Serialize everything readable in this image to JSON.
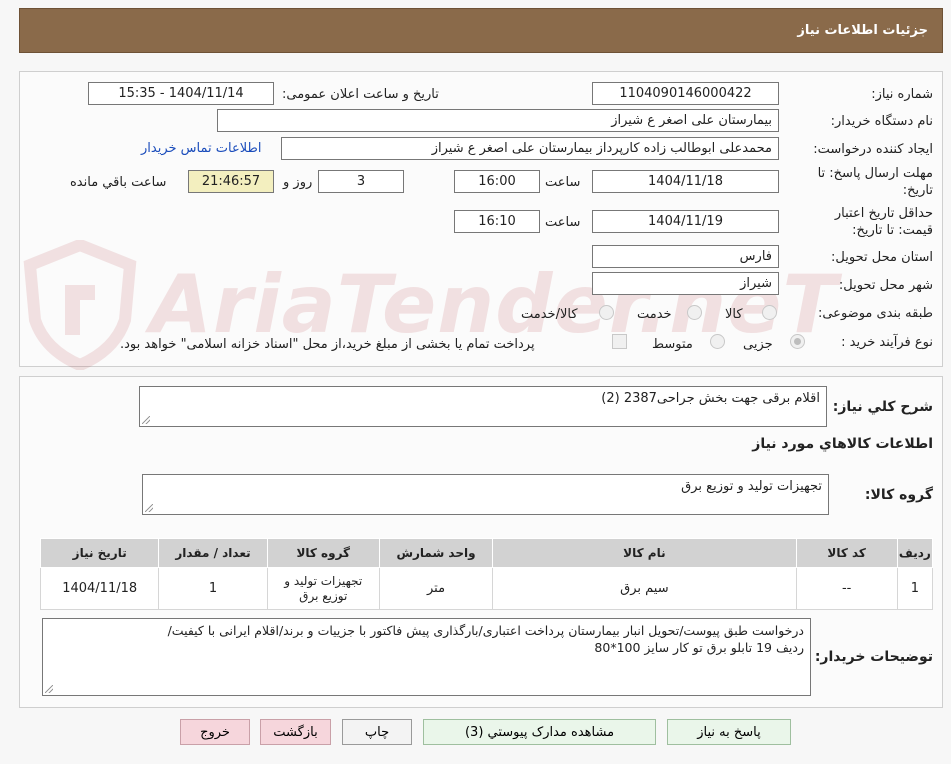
{
  "header": {
    "title": "جزئیات اطلاعات نیاز"
  },
  "form": {
    "need_number": {
      "label": "شماره نیاز:",
      "value": "1104090146000422"
    },
    "announce": {
      "label": "تاریخ و ساعت اعلان عمومی:",
      "value": "1404/11/14 - 15:35"
    },
    "buyer": {
      "label": "نام دستگاه خریدار:",
      "value": "بیمارستان علی اصغر  ع  شیراز"
    },
    "requester": {
      "label": "ایجاد کننده درخواست:",
      "value": "محمدعلی ابوطالب زاده کارپرداز بیمارستان علی اصغر  ع  شیراز"
    },
    "contact_link": "اطلاعات تماس خریدار",
    "deadline": {
      "label_line1": "مهلت ارسال پاسخ: تا",
      "label_line2": "تاریخ:",
      "date": "1404/11/18",
      "time_label": "ساعت",
      "time": "16:00",
      "days": "3",
      "days_label": "روز و",
      "remaining": "21:46:57",
      "remaining_label": "ساعت باقي مانده"
    },
    "validity": {
      "label_line1": "حداقل تاریخ اعتبار",
      "label_line2": "قیمت: تا تاریخ:",
      "date": "1404/11/19",
      "time_label": "ساعت",
      "time": "16:10"
    },
    "province": {
      "label": "استان محل تحویل:",
      "value": "فارس"
    },
    "city": {
      "label": "شهر محل تحویل:",
      "value": "شیراز"
    },
    "category": {
      "label": "طبقه بندی موضوعی:",
      "options": [
        "کالا",
        "خدمت",
        "کالا/خدمت"
      ]
    },
    "process": {
      "label": "نوع فرآیند خرید :",
      "options": [
        "جزیی",
        "متوسط"
      ],
      "note": "پرداخت تمام یا بخشی از مبلغ خرید،از محل \"اسناد خزانه اسلامی\" خواهد بود."
    }
  },
  "summary": {
    "label": "شرح کلي نياز:",
    "value": "اقلام برقی جهت بخش جراحی2387 (2)",
    "goods_heading": "اطلاعات کالاهاي مورد نياز",
    "group_label": "گروه کالا:",
    "group_value": "تجهیزات تولید و توزیع برق"
  },
  "table": {
    "headers": [
      "رديف",
      "کد کالا",
      "نام کالا",
      "واحد شمارش",
      "گروه کالا",
      "تعداد / مقدار",
      "تاريخ نياز"
    ],
    "rows": [
      [
        "1",
        "--",
        "سیم برق",
        "متر",
        "تجهیزات تولید و توزیع برق",
        "1",
        "1404/11/18"
      ]
    ]
  },
  "notes": {
    "label": "توضیحات خریدار:",
    "line1": "درخواست طبق پیوست/تحویل انبار بیمارستان پرداخت اعتباری/بارگذاری پیش فاکتور با جزییات و برند/اقلام ایرانی با کیفیت/",
    "line2": "ردیف 19 تابلو برق تو کار سایز 100*80"
  },
  "buttons": {
    "reply": "پاسخ به نياز",
    "attachments": "مشاهده مدارک پيوستي (3)",
    "print": "چاپ",
    "back": "بازگشت",
    "exit": "خروج"
  },
  "colors": {
    "header": "#8a6a4a",
    "link": "#1a4cbb",
    "remaining_bg": "#f3efbf",
    "table_header": "#d2d2d2"
  },
  "watermark": "AriaTender.neT"
}
